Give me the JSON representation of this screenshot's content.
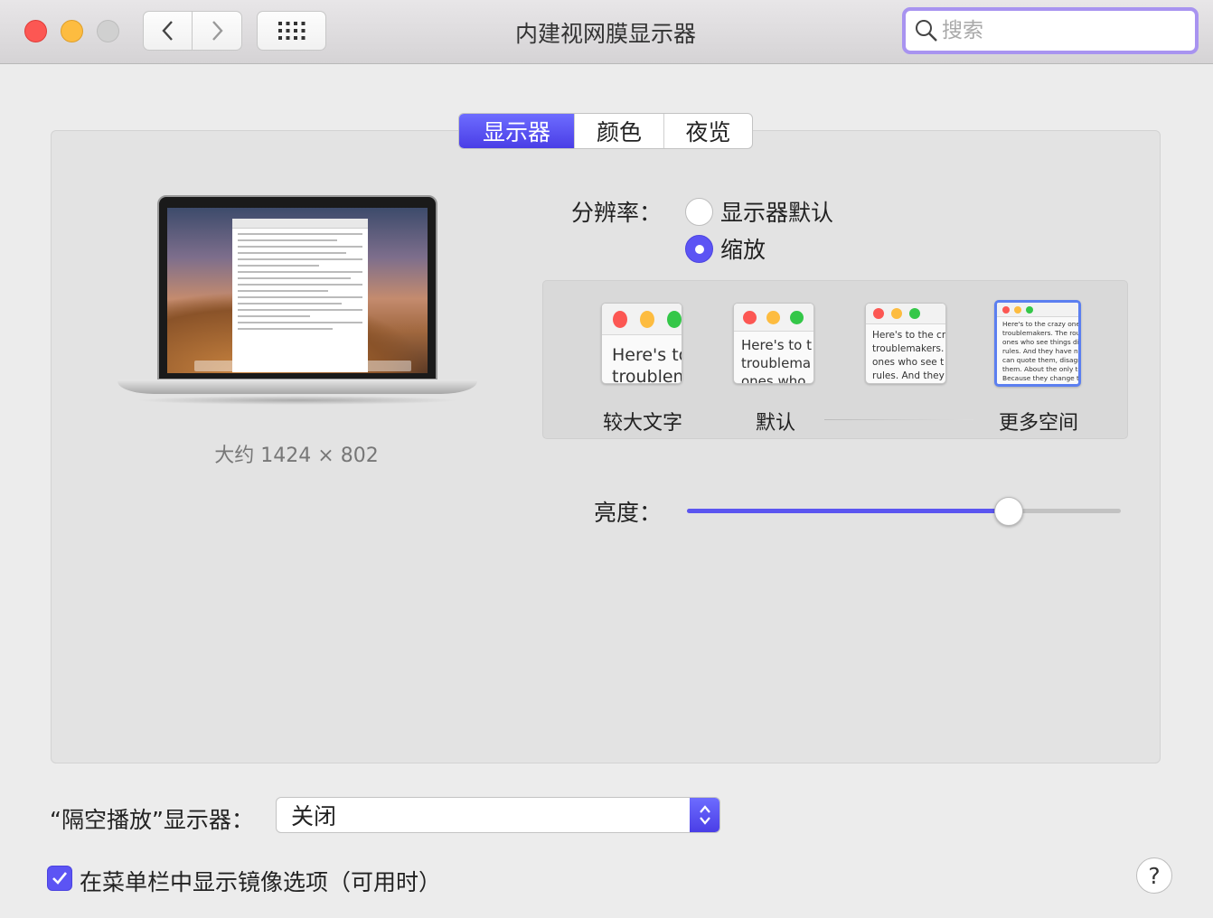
{
  "window": {
    "title": "内建视网膜显示器",
    "search_placeholder": "搜索"
  },
  "tabs": [
    {
      "label": "显示器",
      "active": true
    },
    {
      "label": "颜色",
      "active": false
    },
    {
      "label": "夜览",
      "active": false
    }
  ],
  "display": {
    "resolution_caption": "大约 1424 × 802",
    "resolution_label": "分辨率：",
    "resolution_options": [
      {
        "label": "显示器默认",
        "selected": false
      },
      {
        "label": "缩放",
        "selected": true
      }
    ],
    "scale_options": [
      {
        "label": "较大文字",
        "preview": "Here's to\ntroublem",
        "selected": false
      },
      {
        "label": "默认",
        "preview": "Here's to t\ntroublema\nones who",
        "selected": false
      },
      {
        "label": "",
        "preview": "Here's to the cr\ntroublemakers.\nones who see t\nrules. And they",
        "selected": false
      },
      {
        "label": "更多空间",
        "preview": "Here's to the crazy one\ntroublemakers. The rou\nones who see things di\nrules. And they have no\ncan quote them, disagr\nthem. About the only th\nBecause they change t",
        "selected": true
      }
    ],
    "brightness_label": "亮度：",
    "brightness_value": 0.74
  },
  "airplay": {
    "label": "“隔空播放”显示器：",
    "value": "关闭"
  },
  "mirroring": {
    "label": "在菜单栏中显示镜像选项（可用时）",
    "checked": true
  },
  "help_label": "?",
  "colors": {
    "accent": "#5c54f4",
    "close": "#fc5753",
    "minimize": "#fdbc40"
  }
}
